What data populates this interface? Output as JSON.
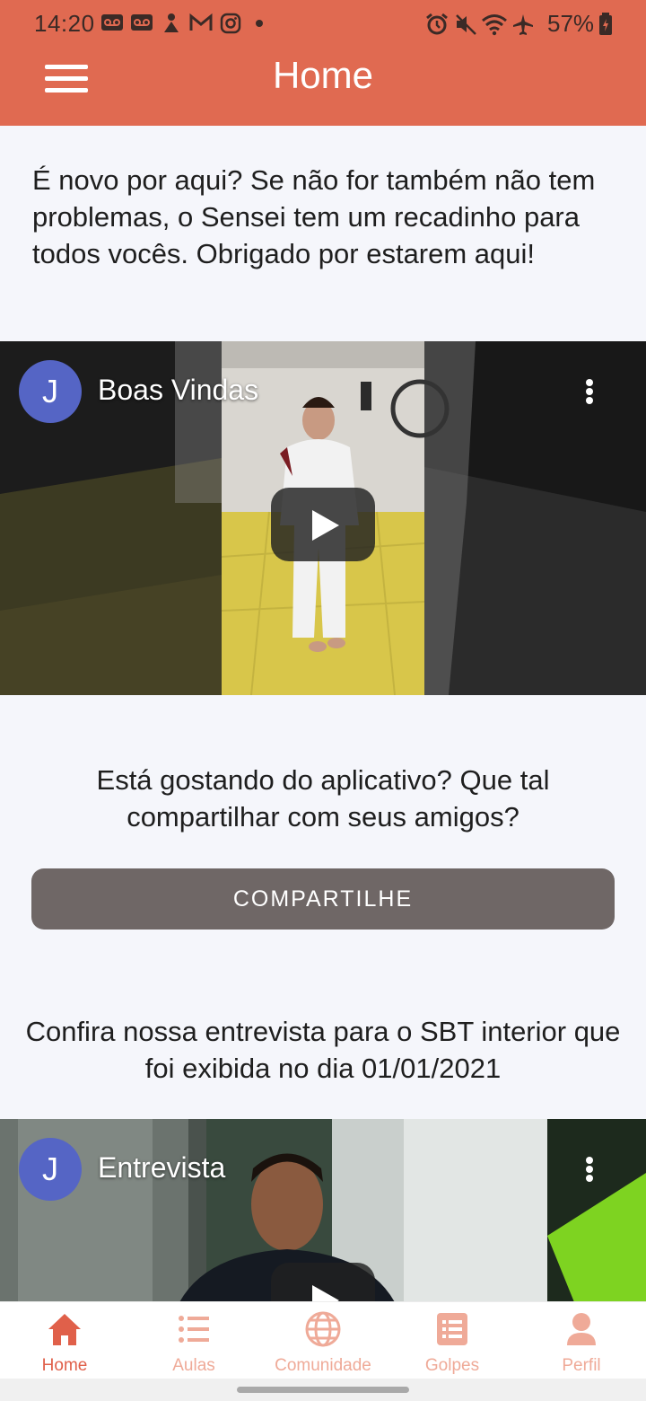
{
  "status_bar": {
    "time": "14:20",
    "battery": "57%",
    "left_icons": [
      "voicemail-icon",
      "voicemail-icon",
      "game-icon",
      "gmail-icon",
      "instagram-icon",
      "dot-icon"
    ],
    "right_icons": [
      "alarm-icon",
      "mute-icon",
      "wifi-icon",
      "airplane-icon",
      "battery-charging-icon"
    ]
  },
  "app_bar": {
    "title": "Home",
    "menu_icon": "hamburger-menu-icon"
  },
  "intro_text": "É novo por aqui? Se não for também não tem problemas, o Sensei tem um recadinho para todos vocês. Obrigado por estarem aqui!",
  "video_welcome": {
    "avatar_letter": "J",
    "title": "Boas Vindas"
  },
  "share_prompt": "Está gostando do aplicativo? Que tal compartilhar com seus amigos?",
  "share_button": "COMPARTILHE",
  "interview_text": "Confira nossa entrevista para o SBT interior que foi exibida no dia 01/01/2021",
  "video_interview": {
    "avatar_letter": "J",
    "title": "Entrevista"
  },
  "bottom_nav": [
    {
      "label": "Home",
      "icon": "home-icon",
      "active": true
    },
    {
      "label": "Aulas",
      "icon": "list-icon",
      "active": false
    },
    {
      "label": "Comunidade",
      "icon": "globe-icon",
      "active": false
    },
    {
      "label": "Golpes",
      "icon": "book-list-icon",
      "active": false
    },
    {
      "label": "Perfil",
      "icon": "person-icon",
      "active": false
    }
  ],
  "colors": {
    "app_bar": "#e06a51",
    "nav_active": "#e0604a",
    "nav_inactive": "#efaa98",
    "button": "#6f6766",
    "avatar": "#5565c5"
  }
}
